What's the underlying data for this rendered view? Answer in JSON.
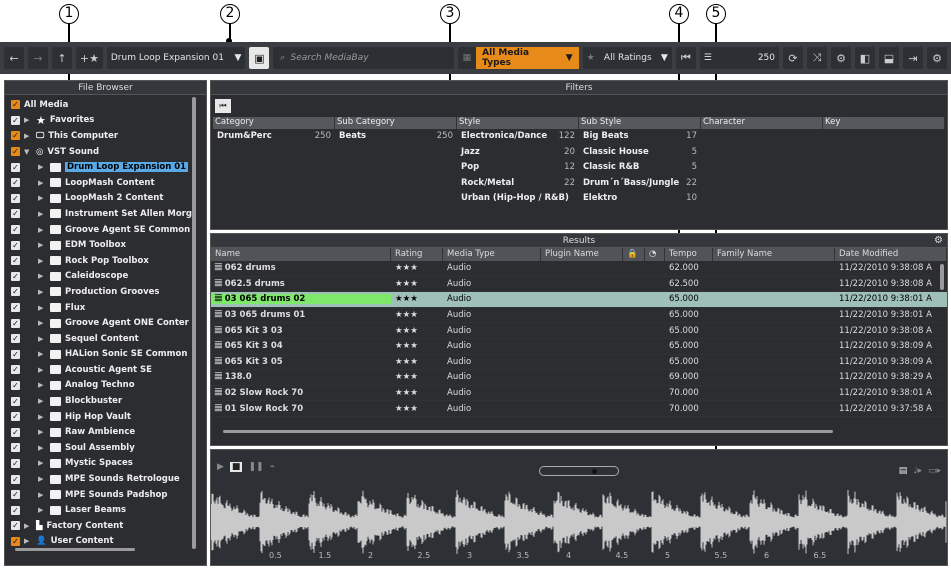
{
  "callouts": [
    "1",
    "2",
    "3",
    "4",
    "5"
  ],
  "toolbar": {
    "collection": "Drum Loop Expansion 01",
    "search_placeholder": "Search MediaBay",
    "media_types": "All Media Types",
    "ratings": "All Ratings",
    "result_count": "250"
  },
  "file_browser": {
    "title": "File Browser",
    "items": [
      {
        "label": "All Media"
      },
      {
        "label": "Favorites"
      },
      {
        "label": "This Computer"
      },
      {
        "label": "VST Sound"
      },
      {
        "label": "Drum Loop Expansion 01"
      },
      {
        "label": "LoopMash Content"
      },
      {
        "label": "LoopMash 2 Content"
      },
      {
        "label": "Instrument Set Allen Morg"
      },
      {
        "label": "Groove Agent SE Common"
      },
      {
        "label": "EDM Toolbox"
      },
      {
        "label": "Rock Pop Toolbox"
      },
      {
        "label": "Caleidoscope"
      },
      {
        "label": "Production Grooves"
      },
      {
        "label": "Flux"
      },
      {
        "label": "Groove Agent ONE Conter"
      },
      {
        "label": "Sequel Content"
      },
      {
        "label": "HALion Sonic SE Common"
      },
      {
        "label": "Acoustic Agent SE"
      },
      {
        "label": "Analog Techno"
      },
      {
        "label": "Blockbuster"
      },
      {
        "label": "Hip Hop Vault"
      },
      {
        "label": "Raw Ambience"
      },
      {
        "label": "Soul Assembly"
      },
      {
        "label": "Mystic Spaces"
      },
      {
        "label": "MPE Sounds Retrologue"
      },
      {
        "label": "MPE Sounds Padshop"
      },
      {
        "label": "Laser Beams"
      },
      {
        "label": "Factory Content"
      },
      {
        "label": "User Content"
      }
    ]
  },
  "filters": {
    "title": "Filters",
    "headers": [
      "Category",
      "Sub Category",
      "Style",
      "Sub Style",
      "Character",
      "Key"
    ],
    "category": [
      {
        "name": "Drum&Perc",
        "count": "250"
      }
    ],
    "sub_category": [
      {
        "name": "Beats",
        "count": "250"
      }
    ],
    "style": [
      {
        "name": "Electronica/Dance",
        "count": "122"
      },
      {
        "name": "Jazz",
        "count": "20"
      },
      {
        "name": "Pop",
        "count": "12"
      },
      {
        "name": "Rock/Metal",
        "count": "22"
      },
      {
        "name": "Urban (Hip-Hop / R&B)",
        "count": ""
      }
    ],
    "sub_style": [
      {
        "name": "Big Beats",
        "count": "17"
      },
      {
        "name": "Classic House",
        "count": "5"
      },
      {
        "name": "Classic R&B",
        "count": "5"
      },
      {
        "name": "Drum´n´Bass/Jungle",
        "count": "22"
      },
      {
        "name": "Elektro",
        "count": "10"
      }
    ]
  },
  "results": {
    "title": "Results",
    "headers": [
      "Name",
      "Rating",
      "Media Type",
      "Plugin Name",
      "",
      "",
      "Tempo",
      "Family Name",
      "Date Modified"
    ],
    "rows": [
      {
        "name": "062 drums",
        "rating": "★★★",
        "type": "Audio",
        "tempo": "62.000",
        "date": "11/22/2010 9:38:08 A"
      },
      {
        "name": "062.5 drums",
        "rating": "★★★",
        "type": "Audio",
        "tempo": "62.500",
        "date": "11/22/2010 9:38:08 A"
      },
      {
        "name": "03 065 drums 02",
        "rating": "★★★",
        "type": "Audio",
        "tempo": "65.000",
        "date": "11/22/2010 9:38:01 A"
      },
      {
        "name": "03 065 drums 01",
        "rating": "★★★",
        "type": "Audio",
        "tempo": "65.000",
        "date": "11/22/2010 9:38:01 A"
      },
      {
        "name": "065 Kit 3 03",
        "rating": "★★★",
        "type": "Audio",
        "tempo": "65.000",
        "date": "11/22/2010 9:38:08 A"
      },
      {
        "name": "065 Kit 3 04",
        "rating": "★★★",
        "type": "Audio",
        "tempo": "65.000",
        "date": "11/22/2010 9:38:09 A"
      },
      {
        "name": "065 Kit 3 05",
        "rating": "★★★",
        "type": "Audio",
        "tempo": "65.000",
        "date": "11/22/2010 9:38:09 A"
      },
      {
        "name": "138.0",
        "rating": "★★★",
        "type": "Audio",
        "tempo": "69.000",
        "date": "11/22/2010 9:38:29 A"
      },
      {
        "name": "02 Slow Rock 70",
        "rating": "★★★",
        "type": "Audio",
        "tempo": "70.000",
        "date": "11/22/2010 9:38:01 A"
      },
      {
        "name": "01 Slow Rock 70",
        "rating": "★★★",
        "type": "Audio",
        "tempo": "70.000",
        "date": "11/22/2010 9:37:58 A"
      }
    ]
  },
  "preview": {
    "ticks": [
      "0.5",
      "1.5",
      "2",
      "2.5",
      "3",
      "3.5",
      "4",
      "4.5",
      "5",
      "5.5",
      "6",
      "6.5"
    ]
  }
}
